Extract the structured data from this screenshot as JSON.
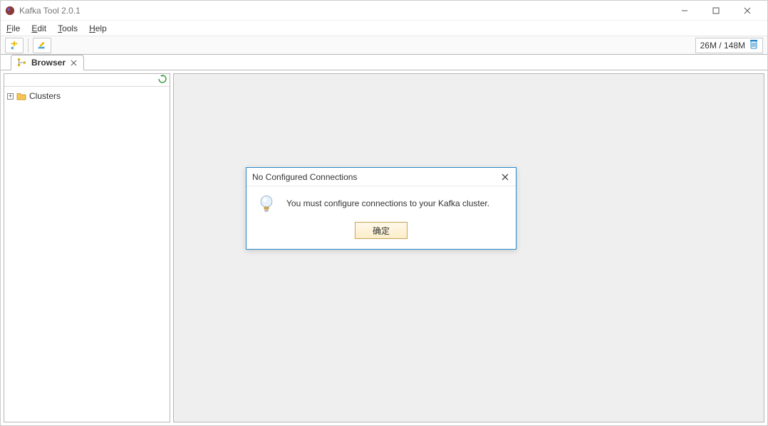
{
  "titlebar": {
    "title": "Kafka Tool  2.0.1"
  },
  "menu": {
    "file": "File",
    "edit": "Edit",
    "tools": "Tools",
    "help": "Help"
  },
  "toolbar": {
    "memory": "26M / 148M"
  },
  "tab": {
    "label": "Browser"
  },
  "tree": {
    "root": "Clusters"
  },
  "dialog": {
    "title": "No Configured Connections",
    "message": "You must configure connections to your Kafka cluster.",
    "ok": "确定"
  }
}
